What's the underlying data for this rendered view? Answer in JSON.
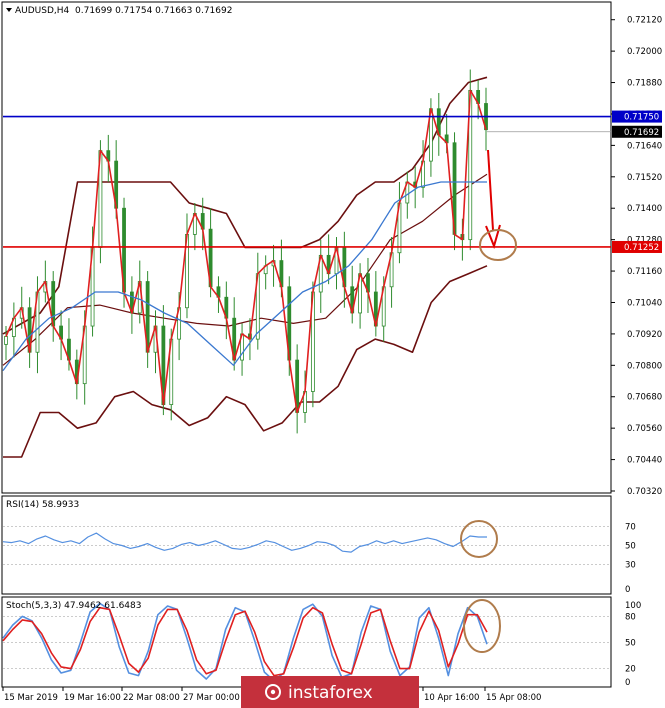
{
  "header": {
    "symbol": "AUDUSD,H4",
    "ohlc": "0.71699 0.71754 0.71663 0.71692"
  },
  "rsi": {
    "label": "RSI(14) 58.9933",
    "levels": [
      "70",
      "50",
      "30",
      "0"
    ]
  },
  "stoch": {
    "label": "Stoch(5,3,3) 47.9462 61.6483",
    "levels": [
      "100",
      "80",
      "50",
      "20",
      "0"
    ]
  },
  "watermark": "instaforex",
  "colors": {
    "candle": "#2e8b2e",
    "bollinger": "#6b0f0f",
    "ma_fast": "#e02020",
    "ma_slow": "#3a78d0",
    "resistance": "#0000c8",
    "support": "#e00000",
    "annotation_circle": "#b07c4c",
    "stoch_main": "#5590e0",
    "stoch_signal": "#e02020",
    "rsi": "#5590e0",
    "watermark_bg": "#c4303c"
  },
  "chart_data": [
    {
      "type": "candlestick",
      "title": "AUDUSD,H4",
      "ylim": [
        0.7032,
        0.7218
      ],
      "y_ticks": [
        "0.72120",
        "0.72000",
        "0.71880",
        "0.71760",
        "0.71640",
        "0.71520",
        "0.71400",
        "0.71280",
        "0.71160",
        "0.71040",
        "0.70920",
        "0.70800",
        "0.70680",
        "0.70560",
        "0.70440",
        "0.70320"
      ],
      "x_ticks": [
        "15 Mar 2019",
        "19 Mar 16:00",
        "22 Mar 08:00",
        "27 Mar 00:00",
        "10 Apr 16:00",
        "15 Apr 08:00"
      ],
      "levels": [
        {
          "name": "resistance",
          "value": 0.7175,
          "label": "0.71750"
        },
        {
          "name": "support",
          "value": 0.71252,
          "label": "0.71252"
        }
      ],
      "current_price": {
        "value": 0.71692,
        "label": "0.71692"
      },
      "close_path": [
        0.7091,
        0.7098,
        0.7102,
        0.7085,
        0.7108,
        0.7112,
        0.7095,
        0.709,
        0.7082,
        0.7073,
        0.7095,
        0.7125,
        0.7162,
        0.7158,
        0.714,
        0.7108,
        0.71,
        0.7112,
        0.7085,
        0.7095,
        0.7065,
        0.709,
        0.7102,
        0.713,
        0.7138,
        0.7132,
        0.711,
        0.7106,
        0.7098,
        0.7082,
        0.7092,
        0.709,
        0.7115,
        0.7118,
        0.712,
        0.711,
        0.7082,
        0.7062,
        0.707,
        0.7108,
        0.7122,
        0.7115,
        0.7125,
        0.711,
        0.71,
        0.7115,
        0.7108,
        0.7095,
        0.711,
        0.7123,
        0.7142,
        0.715,
        0.7148,
        0.7158,
        0.7178,
        0.7168,
        0.7165,
        0.713,
        0.7128,
        0.7185,
        0.718,
        0.717
      ],
      "bollinger_upper": [
        0.7092,
        0.7096,
        0.71,
        0.711,
        0.715,
        0.715,
        0.715,
        0.715,
        0.715,
        0.715,
        0.7142,
        0.714,
        0.7138,
        0.7125,
        0.7125,
        0.7125,
        0.7125,
        0.7128,
        0.7135,
        0.7145,
        0.715,
        0.715,
        0.7155,
        0.7165,
        0.718,
        0.7188,
        0.719
      ],
      "bollinger_lower": [
        0.7045,
        0.7045,
        0.7062,
        0.7062,
        0.7056,
        0.7058,
        0.7068,
        0.707,
        0.7065,
        0.7063,
        0.7057,
        0.706,
        0.7068,
        0.7065,
        0.7055,
        0.7058,
        0.7066,
        0.7066,
        0.7072,
        0.7086,
        0.709,
        0.7088,
        0.7085,
        0.7104,
        0.7112,
        0.7115,
        0.7118
      ],
      "bollinger_mid": [
        0.708,
        0.709,
        0.7102,
        0.7103,
        0.71,
        0.7098,
        0.7096,
        0.7095,
        0.7098,
        0.7096,
        0.7098,
        0.711,
        0.7128,
        0.7135,
        0.7145,
        0.7153
      ],
      "ma_slow": [
        0.7078,
        0.709,
        0.7098,
        0.7102,
        0.7108,
        0.7108,
        0.7105,
        0.71,
        0.7096,
        0.7088,
        0.708,
        0.7092,
        0.71,
        0.7108,
        0.7112,
        0.7118,
        0.7128,
        0.7142,
        0.7148,
        0.715,
        0.715,
        0.715
      ]
    },
    {
      "type": "line",
      "title": "RSI(14) 58.9933",
      "ylim": [
        0,
        100
      ],
      "y_ticks": [
        "70",
        "50",
        "30",
        "0"
      ],
      "values": [
        54,
        53,
        55,
        52,
        57,
        60,
        56,
        53,
        55,
        52,
        59,
        63,
        57,
        52,
        50,
        47,
        49,
        52,
        48,
        45,
        47,
        51,
        53,
        50,
        52,
        55,
        51,
        47,
        46,
        48,
        51,
        55,
        53,
        49,
        45,
        47,
        50,
        54,
        53,
        50,
        44,
        43,
        49,
        51,
        55,
        52,
        55,
        52,
        54,
        56,
        58,
        56,
        52,
        49,
        54,
        60,
        59,
        59
      ]
    },
    {
      "type": "line",
      "title": "Stoch(5,3,3) 47.9462 61.6483",
      "ylim": [
        0,
        100
      ],
      "y_ticks": [
        "100",
        "80",
        "50",
        "20",
        "0"
      ],
      "series": [
        {
          "values": [
            55,
            70,
            80,
            75,
            55,
            30,
            15,
            18,
            50,
            85,
            95,
            88,
            45,
            15,
            12,
            40,
            82,
            92,
            88,
            55,
            18,
            8,
            20,
            65,
            90,
            85,
            52,
            16,
            6,
            15,
            55,
            88,
            94,
            80,
            35,
            10,
            14,
            62,
            92,
            88,
            40,
            12,
            22,
            78,
            90,
            55,
            12,
            60,
            90,
            80,
            48
          ]
        },
        {
          "values": [
            52,
            65,
            76,
            74,
            60,
            38,
            22,
            20,
            42,
            74,
            90,
            88,
            58,
            26,
            16,
            32,
            70,
            88,
            88,
            64,
            30,
            14,
            18,
            52,
            82,
            86,
            62,
            28,
            12,
            14,
            44,
            78,
            90,
            84,
            48,
            18,
            14,
            48,
            84,
            88,
            52,
            20,
            20,
            62,
            86,
            64,
            22,
            48,
            82,
            82,
            62
          ]
        }
      ]
    }
  ]
}
